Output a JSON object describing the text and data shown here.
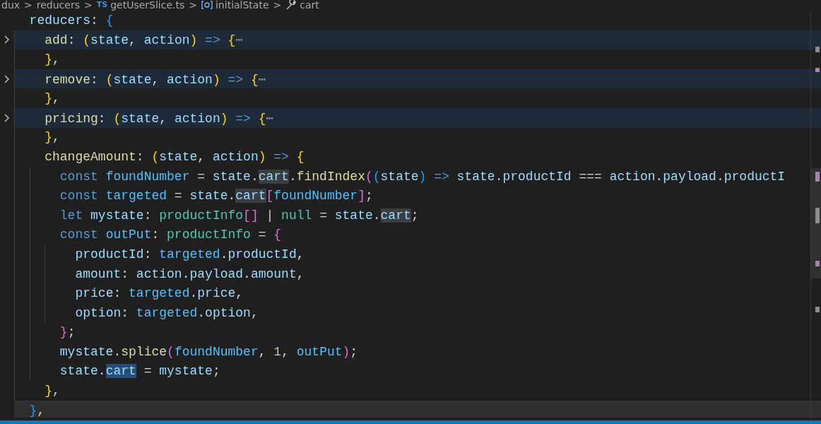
{
  "breadcrumb": [
    {
      "text": "dux",
      "kind": "folder"
    },
    {
      "text": "reducers",
      "kind": "folder"
    },
    {
      "text": "getUserSlice.ts",
      "kind": "file",
      "badge": "TS"
    },
    {
      "text": "initialState",
      "kind": "variable"
    },
    {
      "text": "cart",
      "kind": "property"
    }
  ],
  "separator": ">",
  "lines": [
    {
      "folded": false,
      "current": false,
      "tokens": [
        {
          "text": "reducers",
          "kind": "prop"
        },
        {
          "text": ": ",
          "kind": "punct"
        },
        {
          "text": "{",
          "kind": "b3"
        }
      ],
      "children": [
        {
          "folded": true,
          "current": false,
          "tokens": [
            {
              "text": "add",
              "kind": "fn"
            },
            {
              "text": ": ",
              "kind": "punct"
            },
            {
              "text": "(",
              "kind": "b1"
            },
            {
              "text": "state",
              "kind": "prop"
            },
            {
              "text": ", ",
              "kind": "punct"
            },
            {
              "text": "action",
              "kind": "prop"
            },
            {
              "text": ")",
              "kind": "b1"
            },
            {
              "text": " => ",
              "kind": "keyword"
            },
            {
              "text": "{",
              "kind": "b1"
            },
            {
              "text": "⋯",
              "kind": "ellipsis"
            }
          ]
        },
        {
          "folded": false,
          "current": false,
          "tokens": [
            {
              "text": "}",
              "kind": "b1"
            },
            {
              "text": ",",
              "kind": "punct"
            }
          ]
        },
        {
          "folded": true,
          "current": false,
          "tokens": [
            {
              "text": "remove",
              "kind": "fn"
            },
            {
              "text": ": ",
              "kind": "punct"
            },
            {
              "text": "(",
              "kind": "b1"
            },
            {
              "text": "state",
              "kind": "prop"
            },
            {
              "text": ", ",
              "kind": "punct"
            },
            {
              "text": "action",
              "kind": "prop"
            },
            {
              "text": ")",
              "kind": "b1"
            },
            {
              "text": " => ",
              "kind": "keyword"
            },
            {
              "text": "{",
              "kind": "b1"
            },
            {
              "text": "⋯",
              "kind": "ellipsis"
            }
          ]
        },
        {
          "folded": false,
          "current": false,
          "tokens": [
            {
              "text": "}",
              "kind": "b1"
            },
            {
              "text": ",",
              "kind": "punct"
            }
          ]
        },
        {
          "folded": true,
          "current": false,
          "tokens": [
            {
              "text": "pricing",
              "kind": "fn"
            },
            {
              "text": ": ",
              "kind": "punct"
            },
            {
              "text": "(",
              "kind": "b1"
            },
            {
              "text": "state",
              "kind": "prop"
            },
            {
              "text": ", ",
              "kind": "punct"
            },
            {
              "text": "action",
              "kind": "prop"
            },
            {
              "text": ")",
              "kind": "b1"
            },
            {
              "text": " => ",
              "kind": "keyword"
            },
            {
              "text": "{",
              "kind": "b1"
            },
            {
              "text": "⋯",
              "kind": "ellipsis"
            }
          ]
        },
        {
          "folded": false,
          "current": false,
          "tokens": [
            {
              "text": "}",
              "kind": "b1"
            },
            {
              "text": ",",
              "kind": "punct"
            }
          ]
        },
        {
          "folded": false,
          "current": false,
          "tokens": [
            {
              "text": "changeAmount",
              "kind": "fn"
            },
            {
              "text": ": ",
              "kind": "punct"
            },
            {
              "text": "(",
              "kind": "b1"
            },
            {
              "text": "state",
              "kind": "prop"
            },
            {
              "text": ", ",
              "kind": "punct"
            },
            {
              "text": "action",
              "kind": "prop"
            },
            {
              "text": ")",
              "kind": "b1"
            },
            {
              "text": " => ",
              "kind": "keyword"
            },
            {
              "text": "{",
              "kind": "b1"
            }
          ],
          "children": [
            {
              "folded": false,
              "current": false,
              "tokens": [
                {
                  "text": "const ",
                  "kind": "keyword"
                },
                {
                  "text": "foundNumber",
                  "kind": "const"
                },
                {
                  "text": " = ",
                  "kind": "punct"
                },
                {
                  "text": "state",
                  "kind": "prop"
                },
                {
                  "text": ".",
                  "kind": "punct"
                },
                {
                  "text": "cart",
                  "kind": "prop",
                  "highlighted": true
                },
                {
                  "text": ".",
                  "kind": "punct"
                },
                {
                  "text": "findIndex",
                  "kind": "fn"
                },
                {
                  "text": "(",
                  "kind": "b2"
                },
                {
                  "text": "(",
                  "kind": "b3"
                },
                {
                  "text": "state",
                  "kind": "prop"
                },
                {
                  "text": ")",
                  "kind": "b3"
                },
                {
                  "text": " => ",
                  "kind": "keyword"
                },
                {
                  "text": "state",
                  "kind": "prop"
                },
                {
                  "text": ".",
                  "kind": "punct"
                },
                {
                  "text": "productId",
                  "kind": "prop"
                },
                {
                  "text": " === ",
                  "kind": "punct"
                },
                {
                  "text": "action",
                  "kind": "prop"
                },
                {
                  "text": ".",
                  "kind": "punct"
                },
                {
                  "text": "payload",
                  "kind": "prop"
                },
                {
                  "text": ".",
                  "kind": "punct"
                },
                {
                  "text": "productI",
                  "kind": "prop"
                }
              ]
            },
            {
              "folded": false,
              "current": false,
              "tokens": [
                {
                  "text": "const ",
                  "kind": "keyword"
                },
                {
                  "text": "targeted",
                  "kind": "const"
                },
                {
                  "text": " = ",
                  "kind": "punct"
                },
                {
                  "text": "state",
                  "kind": "prop"
                },
                {
                  "text": ".",
                  "kind": "punct"
                },
                {
                  "text": "cart",
                  "kind": "prop",
                  "highlighted": true
                },
                {
                  "text": "[",
                  "kind": "b2"
                },
                {
                  "text": "foundNumber",
                  "kind": "const"
                },
                {
                  "text": "]",
                  "kind": "b2"
                },
                {
                  "text": ";",
                  "kind": "punct"
                }
              ]
            },
            {
              "folded": false,
              "current": false,
              "tokens": [
                {
                  "text": "let ",
                  "kind": "keyword"
                },
                {
                  "text": "mystate",
                  "kind": "prop"
                },
                {
                  "text": ": ",
                  "kind": "punct"
                },
                {
                  "text": "productInfo",
                  "kind": "type"
                },
                {
                  "text": "[]",
                  "kind": "b2"
                },
                {
                  "text": " | ",
                  "kind": "punct"
                },
                {
                  "text": "null",
                  "kind": "type"
                },
                {
                  "text": " = ",
                  "kind": "punct"
                },
                {
                  "text": "state",
                  "kind": "prop"
                },
                {
                  "text": ".",
                  "kind": "punct"
                },
                {
                  "text": "cart",
                  "kind": "prop",
                  "highlighted": true
                },
                {
                  "text": ";",
                  "kind": "punct"
                }
              ]
            },
            {
              "folded": false,
              "current": false,
              "tokens": [
                {
                  "text": "const ",
                  "kind": "keyword"
                },
                {
                  "text": "outPut",
                  "kind": "const"
                },
                {
                  "text": ": ",
                  "kind": "punct"
                },
                {
                  "text": "productInfo",
                  "kind": "type"
                },
                {
                  "text": " = ",
                  "kind": "punct"
                },
                {
                  "text": "{",
                  "kind": "b2"
                }
              ],
              "children": [
                {
                  "folded": false,
                  "current": false,
                  "tokens": [
                    {
                      "text": "productId",
                      "kind": "prop"
                    },
                    {
                      "text": ": ",
                      "kind": "punct"
                    },
                    {
                      "text": "targeted",
                      "kind": "const"
                    },
                    {
                      "text": ".",
                      "kind": "punct"
                    },
                    {
                      "text": "productId",
                      "kind": "prop"
                    },
                    {
                      "text": ",",
                      "kind": "punct"
                    }
                  ]
                },
                {
                  "folded": false,
                  "current": false,
                  "tokens": [
                    {
                      "text": "amount",
                      "kind": "prop"
                    },
                    {
                      "text": ": ",
                      "kind": "punct"
                    },
                    {
                      "text": "action",
                      "kind": "prop"
                    },
                    {
                      "text": ".",
                      "kind": "punct"
                    },
                    {
                      "text": "payload",
                      "kind": "prop"
                    },
                    {
                      "text": ".",
                      "kind": "punct"
                    },
                    {
                      "text": "amount",
                      "kind": "prop"
                    },
                    {
                      "text": ",",
                      "kind": "punct"
                    }
                  ]
                },
                {
                  "folded": false,
                  "current": false,
                  "tokens": [
                    {
                      "text": "price",
                      "kind": "prop"
                    },
                    {
                      "text": ": ",
                      "kind": "punct"
                    },
                    {
                      "text": "targeted",
                      "kind": "const"
                    },
                    {
                      "text": ".",
                      "kind": "punct"
                    },
                    {
                      "text": "price",
                      "kind": "prop"
                    },
                    {
                      "text": ",",
                      "kind": "punct"
                    }
                  ]
                },
                {
                  "folded": false,
                  "current": false,
                  "tokens": [
                    {
                      "text": "option",
                      "kind": "prop"
                    },
                    {
                      "text": ": ",
                      "kind": "punct"
                    },
                    {
                      "text": "targeted",
                      "kind": "const"
                    },
                    {
                      "text": ".",
                      "kind": "punct"
                    },
                    {
                      "text": "option",
                      "kind": "prop"
                    },
                    {
                      "text": ",",
                      "kind": "punct"
                    }
                  ]
                }
              ]
            },
            {
              "folded": false,
              "current": false,
              "tokens": [
                {
                  "text": "}",
                  "kind": "b2"
                },
                {
                  "text": ";",
                  "kind": "punct"
                }
              ]
            },
            {
              "folded": false,
              "current": false,
              "tokens": [
                {
                  "text": "mystate",
                  "kind": "prop"
                },
                {
                  "text": ".",
                  "kind": "punct"
                },
                {
                  "text": "splice",
                  "kind": "fn"
                },
                {
                  "text": "(",
                  "kind": "b2"
                },
                {
                  "text": "foundNumber",
                  "kind": "const"
                },
                {
                  "text": ", ",
                  "kind": "punct"
                },
                {
                  "text": "1",
                  "kind": "number"
                },
                {
                  "text": ", ",
                  "kind": "punct"
                },
                {
                  "text": "outPut",
                  "kind": "const"
                },
                {
                  "text": ")",
                  "kind": "b2"
                },
                {
                  "text": ";",
                  "kind": "punct"
                }
              ]
            },
            {
              "folded": false,
              "current": false,
              "tokens": [
                {
                  "text": "state",
                  "kind": "prop"
                },
                {
                  "text": ".",
                  "kind": "punct"
                },
                {
                  "text": "cart",
                  "kind": "prop",
                  "selected": true
                },
                {
                  "text": " = ",
                  "kind": "punct"
                },
                {
                  "text": "mystate",
                  "kind": "prop"
                },
                {
                  "text": ";",
                  "kind": "punct"
                }
              ]
            }
          ]
        },
        {
          "folded": false,
          "current": false,
          "tokens": [
            {
              "text": "}",
              "kind": "b1"
            },
            {
              "text": ",",
              "kind": "punct"
            }
          ]
        }
      ]
    },
    {
      "folded": false,
      "current": true,
      "tokens": [
        {
          "text": "}",
          "kind": "b3"
        },
        {
          "text": ",",
          "kind": "punct"
        }
      ]
    }
  ]
}
